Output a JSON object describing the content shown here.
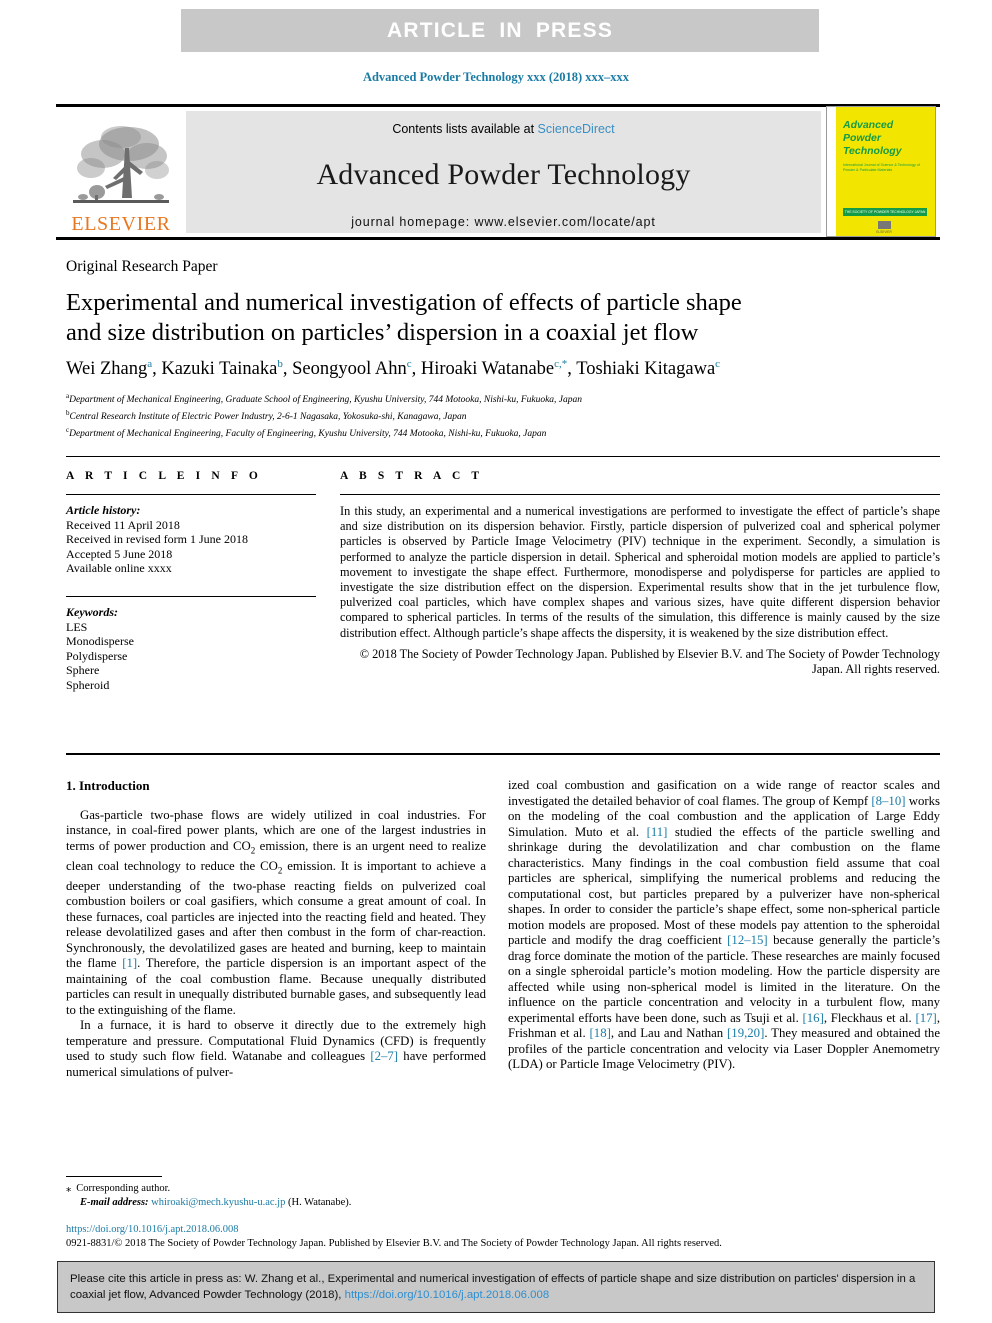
{
  "banner": {
    "text": "ARTICLE IN PRESS"
  },
  "running_head": "Advanced Powder Technology xxx (2018) xxx–xxx",
  "masthead": {
    "contents_prefix": "Contents lists available at ",
    "sciencedirect": "ScienceDirect",
    "journal_title": "Advanced Powder Technology",
    "homepage": "journal homepage: www.elsevier.com/locate/apt",
    "publisher_wordmark": "ELSEVIER",
    "cover": {
      "line1": "Advanced",
      "line2": "Powder",
      "line3": "Technology",
      "subtitle": "International Journal of Science & Technology of Powder & Particulate Materials",
      "band": "THE SOCIETY OF POWDER TECHNOLOGY JAPAN",
      "publisher": "ELSEVIER"
    }
  },
  "article": {
    "type": "Original Research Paper",
    "title_line1": "Experimental and numerical investigation of effects of particle shape",
    "title_line2": "and size distribution on particles’ dispersion in a coaxial jet flow",
    "authors": [
      {
        "name": "Wei Zhang",
        "marks": "a",
        "sep": ", "
      },
      {
        "name": "Kazuki Tainaka",
        "marks": "b",
        "sep": ", "
      },
      {
        "name": "Seongyool Ahn",
        "marks": "c",
        "sep": ", "
      },
      {
        "name": "Hiroaki Watanabe",
        "marks": "c,*",
        "sep": ", "
      },
      {
        "name": "Toshiaki Kitagawa",
        "marks": "c",
        "sep": ""
      }
    ],
    "affiliations": [
      {
        "mark": "a",
        "text": "Department of Mechanical Engineering, Graduate School of Engineering, Kyushu University, 744 Motooka, Nishi-ku, Fukuoka, Japan"
      },
      {
        "mark": "b",
        "text": "Central Research Institute of Electric Power Industry, 2-6-1 Nagasaka, Yokosuka-shi, Kanagawa, Japan"
      },
      {
        "mark": "c",
        "text": "Department of Mechanical Engineering, Faculty of Engineering, Kyushu University, 744 Motooka, Nishi-ku, Fukuoka, Japan"
      }
    ]
  },
  "article_info": {
    "heading": "A R T I C L E   I N F O",
    "history_label": "Article history:",
    "history": [
      "Received 11 April 2018",
      "Received in revised form 1 June 2018",
      "Accepted 5 June 2018",
      "Available online xxxx"
    ],
    "keywords_label": "Keywords:",
    "keywords": [
      "LES",
      "Monodisperse",
      "Polydisperse",
      "Sphere",
      "Spheroid"
    ]
  },
  "abstract": {
    "heading": "A B S T R A C T",
    "body": "In this study, an experimental and a numerical investigations are performed to investigate the effect of particle’s shape and size distribution on its dispersion behavior. Firstly, particle dispersion of pulverized coal and spherical polymer particles is observed by Particle Image Velocimetry (PIV) technique in the experiment. Secondly, a simulation is performed to analyze the particle dispersion in detail. Spherical and spheroidal motion models are applied to particle’s movement to investigate the shape effect. Furthermore, monodisperse and polydisperse for particles are applied to investigate the size distribution effect on the dispersion. Experimental results show that in the jet turbulence flow, pulverized coal particles, which have complex shapes and various sizes, have quite different dispersion behavior compared to spherical particles. In terms of the results of the simulation, this difference is mainly caused by the size distribution effect. Although particle’s shape affects the dispersity, it is weakened by the size distribution effect.",
    "copyright": "© 2018 The Society of Powder Technology Japan. Published by Elsevier B.V. and The Society of Powder Technology Japan. All rights reserved."
  },
  "intro": {
    "section_title": "1. Introduction",
    "left_p1_a": "Gas-particle two-phase flows are widely utilized in coal industries. For instance, in coal-fired power plants, which are one of the largest industries in terms of power production and CO",
    "left_p1_sub1": "2",
    "left_p1_b": " emission, there is an urgent need to realize clean coal technology to reduce the CO",
    "left_p1_sub2": "2",
    "left_p1_c": " emission. It is important to achieve a deeper understanding of the two-phase reacting fields on pulverized coal combustion boilers or coal gasifiers, which consume a great amount of coal. In these furnaces, coal particles are injected into the reacting field and heated. They release devolatilized gases and after then combust in the form of char-reaction. Synchronously, the devolatilized gases are heated and burning, keep to maintain the flame ",
    "left_p1_ref": "[1]",
    "left_p1_d": ". Therefore, the particle dispersion is an important aspect of the maintaining of the coal combustion flame. Because unequally distributed particles can result in unequally distributed burnable gases, and subsequently lead to the extinguishing of the flame.",
    "left_p2_a": "In a furnace, it is hard to observe it directly due to the extremely high temperature and pressure. Computational Fluid Dynamics (CFD) is frequently used to study such flow field. Watanabe and colleagues ",
    "left_p2_ref": "[2–7]",
    "left_p2_b": " have performed numerical simulations of pulver-",
    "right_a": "ized coal combustion and gasification on a wide range of reactor scales and investigated the detailed behavior of coal flames. The group of Kempf ",
    "right_ref1": "[8–10]",
    "right_b": " works on the modeling of the coal combustion and the application of Large Eddy Simulation. Muto et al. ",
    "right_ref2": "[11]",
    "right_c": " studied the effects of the particle swelling and shrinkage during the devolatilization and char combustion on the flame characteristics. Many findings in the coal combustion field assume that coal particles are spherical, simplifying the numerical problems and reducing the computational cost, but particles prepared by a pulverizer have non-spherical shapes. In order to consider the particle’s shape effect, some non-spherical particle motion models are proposed. Most of these models pay attention to the spheroidal particle and modify the drag coefficient ",
    "right_ref3": "[12–15]",
    "right_d": " because generally the particle’s drag force dominate the motion of the particle. These researches are mainly focused on a single spheroidal particle’s motion modeling. How the particle dispersity are affected while using non-spherical model is limited in the literature. On the influence on the particle concentration and velocity in a turbulent flow, many experimental efforts have been done, such as Tsuji et al. ",
    "right_ref4": "[16]",
    "right_e": ", Fleckhaus et al. ",
    "right_ref5": "[17]",
    "right_f": ", Frishman et al. ",
    "right_ref6": "[18]",
    "right_g": ", and Lau and Nathan ",
    "right_ref7": "[19,20]",
    "right_h": ". They measured and obtained the profiles of the particle concentration and velocity via Laser Doppler Anemometry (LDA) or Particle Image Velocimetry (PIV)."
  },
  "footnote": {
    "star": "⁎",
    "corresponding": "Corresponding author.",
    "email_label": "E-mail address:",
    "email": "whiroaki@mech.kyushu-u.ac.jp",
    "email_owner": "(H. Watanabe)."
  },
  "footer": {
    "doi": "https://doi.org/10.1016/j.apt.2018.06.008",
    "issn": "0921-8831/© 2018 The Society of Powder Technology Japan. Published by Elsevier B.V. and The Society of Powder Technology Japan. All rights reserved."
  },
  "cite_box": {
    "text": "Please cite this article in press as: W. Zhang et al., Experimental and numerical investigation of effects of particle shape and size distribution on particles' dispersion in a coaxial jet flow, Advanced Powder Technology (2018), ",
    "link": "https://doi.org/10.1016/j.apt.2018.06.008"
  },
  "colors": {
    "link_blue": "#1a7ba5",
    "banner_gray": "#c8c8c8",
    "masthead_gray": "#e4e4e4",
    "elsevier_orange": "#e87722",
    "cover_yellow": "#f2e600",
    "cover_green": "#149b48"
  }
}
